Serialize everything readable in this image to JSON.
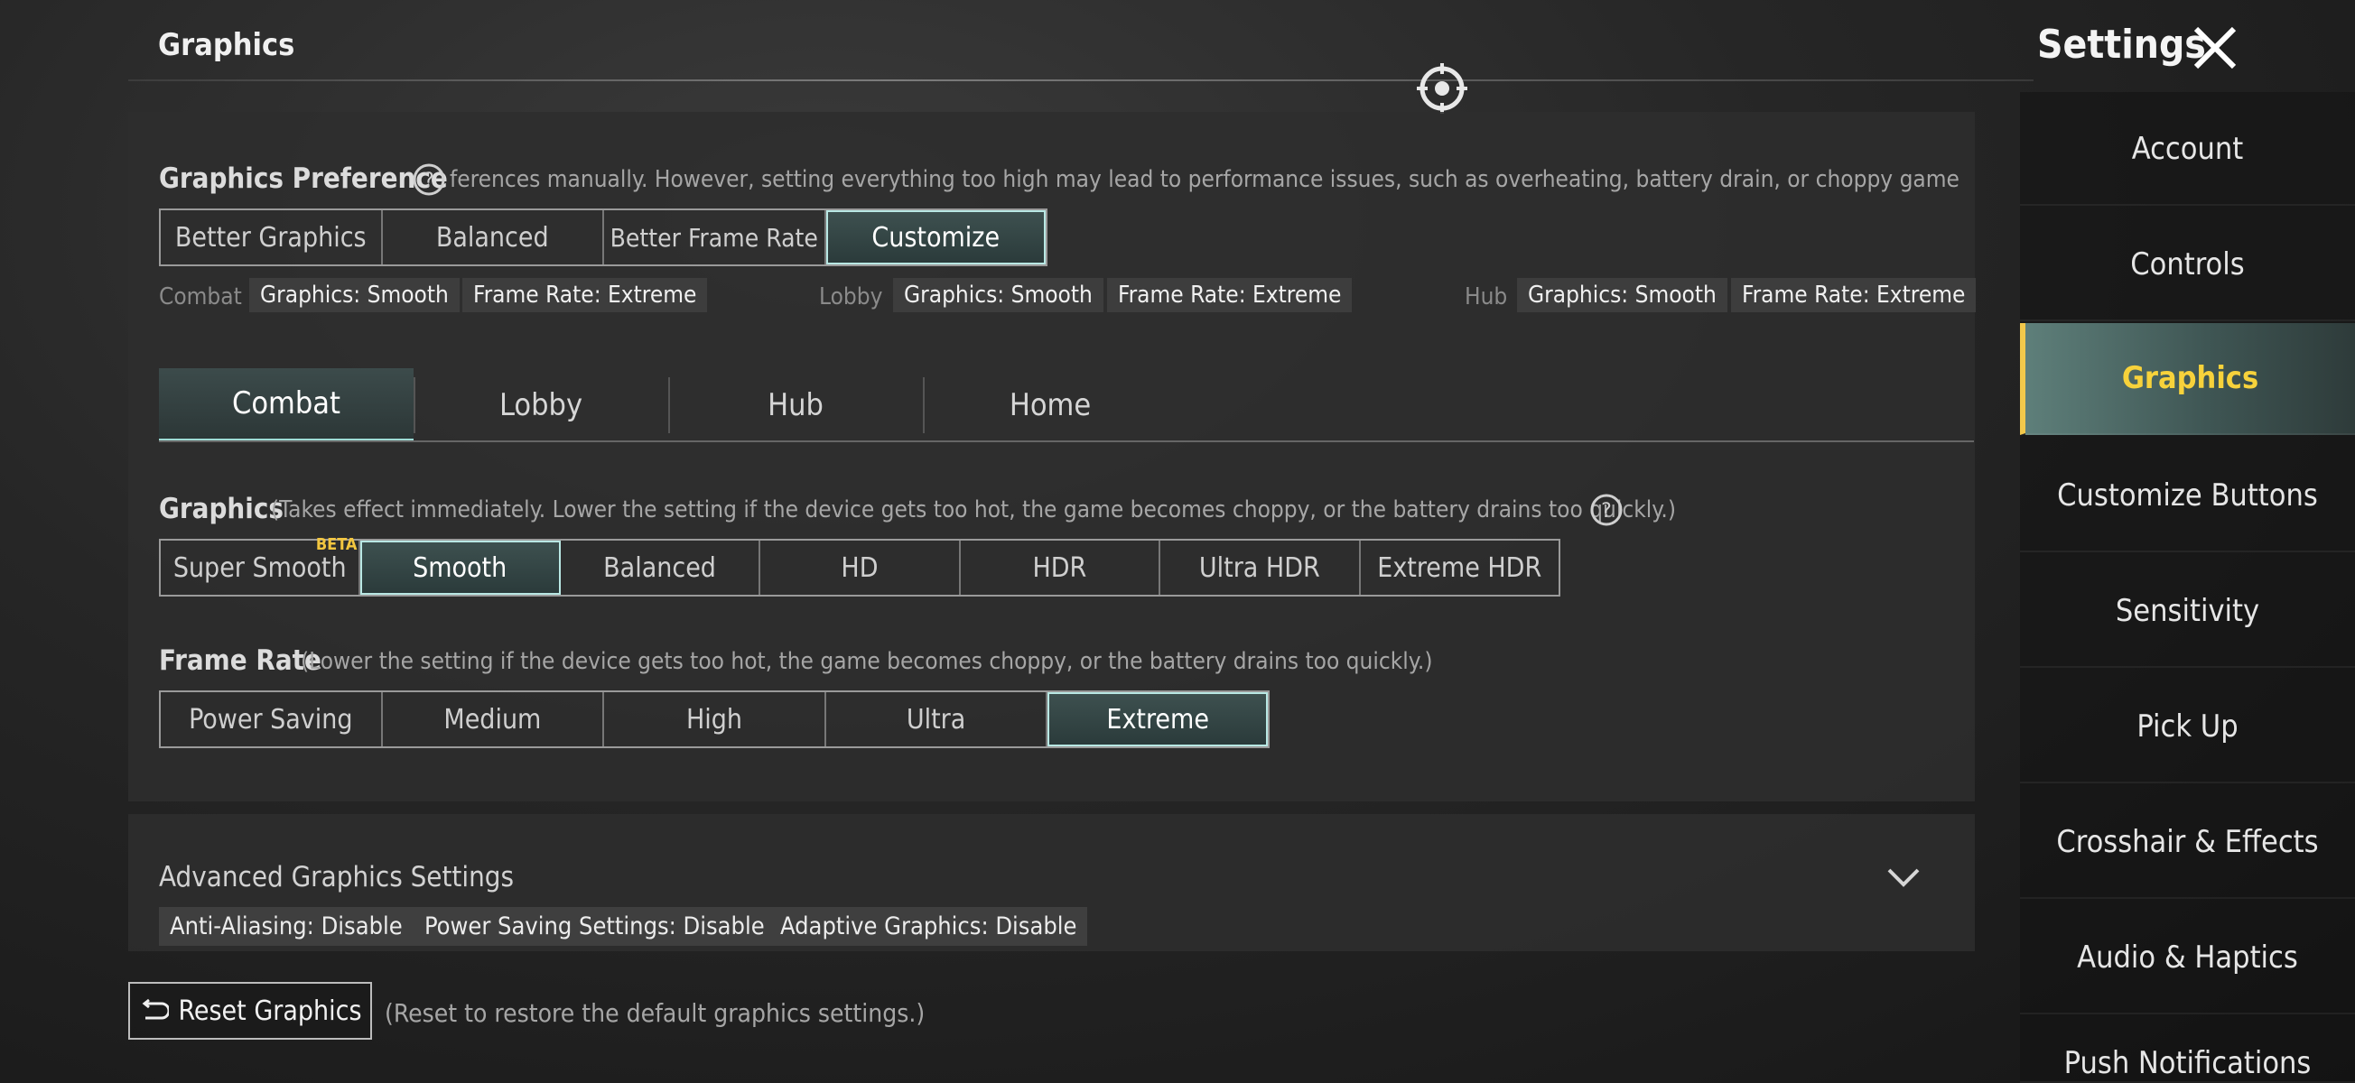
{
  "header": {
    "page_title": "Graphics",
    "settings_title": "Settings"
  },
  "preference": {
    "label": "Graphics Preference",
    "hint": "ferences manually. However, setting everything too high may lead to performance issues, such as overheating, battery drain, or choppy gameplay.",
    "options": [
      "Better Graphics",
      "Balanced",
      "Better Frame Rate",
      "Customize"
    ],
    "selected": "Customize",
    "summaries": [
      {
        "label": "Combat",
        "graphics": "Graphics: Smooth",
        "frame_rate": "Frame Rate: Extreme"
      },
      {
        "label": "Lobby",
        "graphics": "Graphics: Smooth",
        "frame_rate": "Frame Rate: Extreme"
      },
      {
        "label": "Hub",
        "graphics": "Graphics: Smooth",
        "frame_rate": "Frame Rate: Extreme"
      }
    ]
  },
  "mode_tabs": [
    "Combat",
    "Lobby",
    "Hub",
    "Home"
  ],
  "mode_selected": "Combat",
  "graphics": {
    "label": "Graphics",
    "hint": "(Takes effect immediately. Lower the setting if the device gets too hot, the game becomes choppy, or the battery drains too quickly.)",
    "options": [
      "Super Smooth",
      "Smooth",
      "Balanced",
      "HD",
      "HDR",
      "Ultra HDR",
      "Extreme HDR"
    ],
    "beta_badge": "BETA",
    "selected": "Smooth"
  },
  "frame_rate": {
    "label": "Frame Rate",
    "hint": "(Lower the setting if the device gets too hot, the game becomes choppy, or the battery drains too quickly.)",
    "options": [
      "Power Saving",
      "Medium",
      "High",
      "Ultra",
      "Extreme"
    ],
    "selected": "Extreme"
  },
  "advanced": {
    "label": "Advanced Graphics Settings",
    "tags": [
      "Anti-Aliasing: Disable",
      "Power Saving Settings: Disable",
      "Adaptive Graphics: Disable"
    ]
  },
  "reset": {
    "label": "Reset Graphics",
    "hint": "(Reset to restore the default graphics settings.)"
  },
  "sidebar": {
    "items": [
      "Account",
      "Controls",
      "Graphics",
      "Customize Buttons",
      "Sensitivity",
      "Pick Up",
      "Crosshair & Effects",
      "Audio & Haptics",
      "Push Notifications"
    ],
    "selected": "Graphics"
  },
  "colors": {
    "accent_teal": "#b9e8e4",
    "sidebar_selected_text": "#f7d23b"
  }
}
